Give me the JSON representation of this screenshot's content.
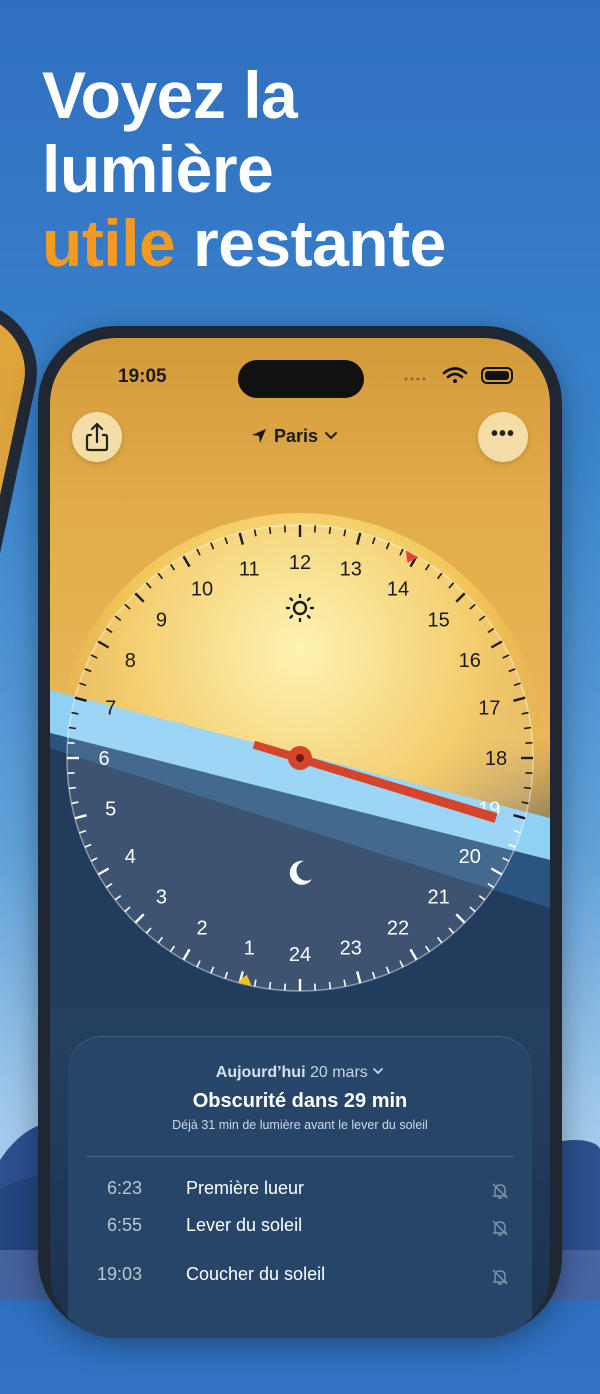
{
  "headline": {
    "line1": "Voyez la",
    "line2": "lumière",
    "accent": "utile",
    "line3_rest": " restante"
  },
  "status": {
    "time": "19:05"
  },
  "header": {
    "location": "Paris"
  },
  "dial": {
    "hours": [
      "1",
      "2",
      "3",
      "4",
      "5",
      "6",
      "7",
      "8",
      "9",
      "10",
      "11",
      "12",
      "13",
      "14",
      "15",
      "16",
      "17",
      "18",
      "19",
      "20",
      "21",
      "22",
      "23",
      "24"
    ],
    "current_time_hours": 19.08
  },
  "card": {
    "date_prefix": "Aujourd’hui",
    "date": "20 mars",
    "headline": "Obscurité dans 29 min",
    "sub": "Déjà 31 min de lumière avant le lever du soleil",
    "events": [
      {
        "time": "6:23",
        "label": "Première lueur"
      },
      {
        "time": "6:55",
        "label": "Lever du soleil"
      },
      {
        "time": "19:03",
        "label": "Coucher du soleil"
      }
    ]
  },
  "colors": {
    "accent": "#f49a1f",
    "sunset_hand": "#d4452c",
    "twilight_band": "#8fd0f5"
  },
  "icons": {
    "share": "share-icon",
    "more": "more-icon",
    "location": "location-arrow-icon",
    "sun": "sun-icon",
    "moon": "moon-icon",
    "bell": "bell-slash-icon"
  }
}
